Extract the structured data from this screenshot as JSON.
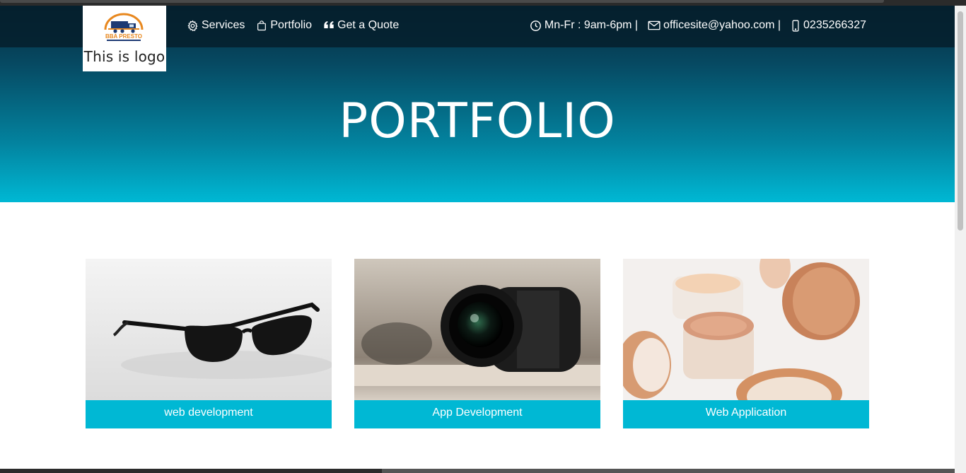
{
  "brand": {
    "logo_text": "BBA PRESTO",
    "logo_caption": "This is logo",
    "accent_orange": "#e8881f",
    "accent_navy": "#1d3a73"
  },
  "nav": {
    "items": [
      {
        "label": "Services",
        "icon": "gear-icon"
      },
      {
        "label": "Portfolio",
        "icon": "shopping-bag-icon"
      },
      {
        "label": "Get a Quote",
        "icon": "quote-icon"
      }
    ]
  },
  "contact": {
    "hours": "Mn-Fr : 9am-6pm |",
    "email": "officesite@yahoo.com |",
    "phone": "0235266327"
  },
  "hero": {
    "title": "PORTFOLIO",
    "gradient_top": "#052b3e",
    "gradient_bottom": "#00b8d4"
  },
  "portfolio": {
    "items": [
      {
        "label": "web development",
        "image": "sunglasses-photo"
      },
      {
        "label": "App Development",
        "image": "camera-lens-photo"
      },
      {
        "label": "Web Application",
        "image": "cosmetic-jars-photo"
      }
    ],
    "label_bg": "#00b8d4"
  }
}
